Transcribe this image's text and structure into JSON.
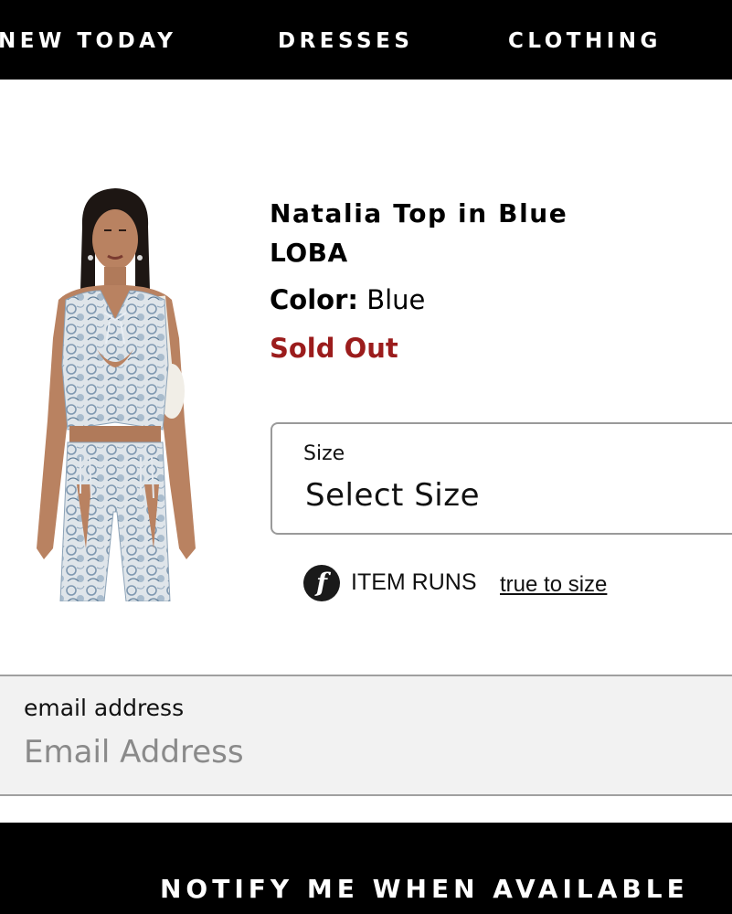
{
  "nav": {
    "items": [
      {
        "label": "NEW TODAY"
      },
      {
        "label": "DRESSES"
      },
      {
        "label": "CLOTHING"
      }
    ]
  },
  "product": {
    "title": "Natalia Top in Blue",
    "brand": "LOBA",
    "color_label": "Color:",
    "color_value": "Blue",
    "status": "Sold Out",
    "image_icon": "product-photo",
    "status_color": "#9b1c1c"
  },
  "size": {
    "label": "Size",
    "value": "Select Size"
  },
  "fit": {
    "icon_glyph": "f",
    "label": "ITEM RUNS",
    "link": "true to size"
  },
  "email": {
    "label": "email address",
    "placeholder": "Email Address",
    "value": ""
  },
  "notify": {
    "label": "NOTIFY ME WHEN AVAILABLE"
  }
}
